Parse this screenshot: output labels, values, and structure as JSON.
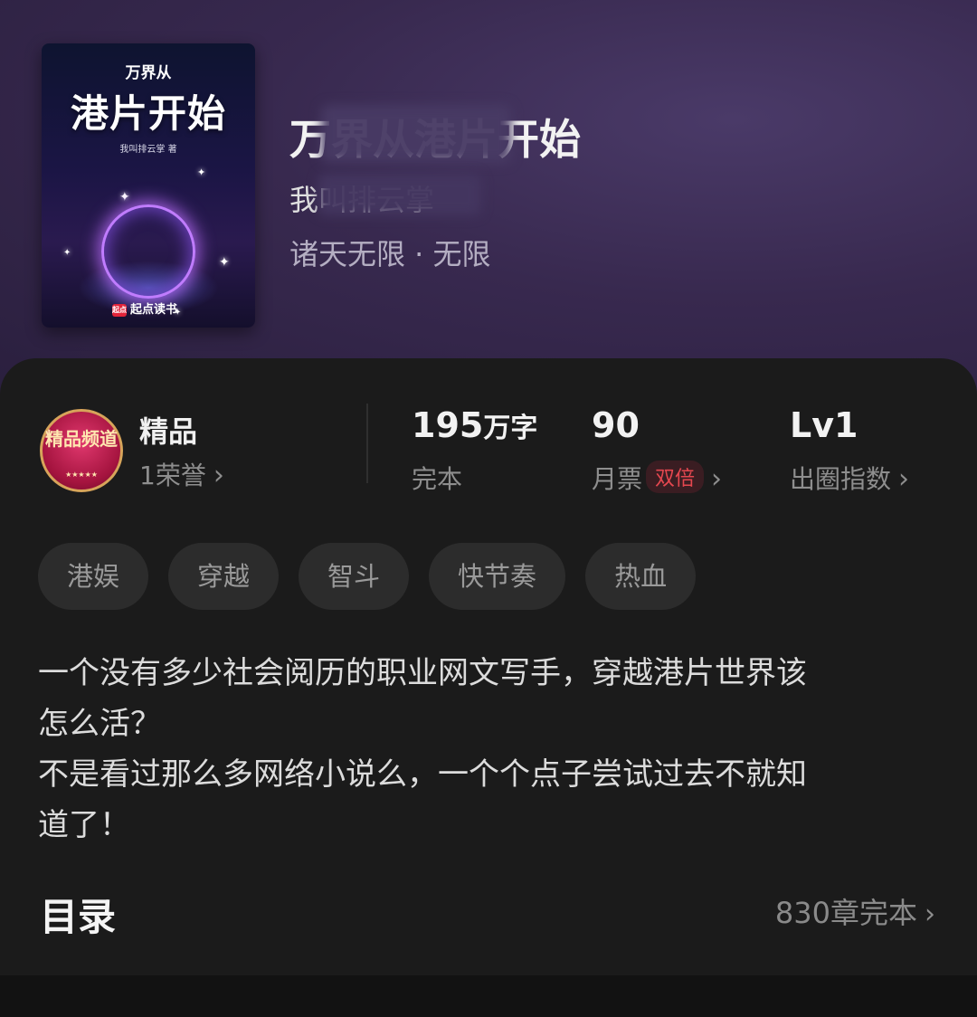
{
  "cover": {
    "top_text": "万界从",
    "main_text": "港片开始",
    "author_text": "我叫排云掌 著",
    "brand": "起点读书",
    "brand_mark": "起点"
  },
  "book": {
    "title": "万界从港片开始",
    "author": "我叫排云掌",
    "genre": "诸天无限 · 无限"
  },
  "honor": {
    "badge_text": "精品频道",
    "badge_stars": "★★★★★",
    "title": "精品",
    "subtitle": "1荣誉"
  },
  "stats": {
    "words": {
      "value": "195",
      "unit": "万字",
      "label": "完本"
    },
    "monthly": {
      "value": "90",
      "label": "月票",
      "badge": "双倍"
    },
    "level": {
      "value": "Lv1",
      "label": "出圈指数"
    }
  },
  "tags": [
    "港娱",
    "穿越",
    "智斗",
    "快节奏",
    "热血"
  ],
  "description": {
    "line1": "一个没有多少社会阅历的职业网文写手，穿越港片世界该",
    "line2": "怎么活？",
    "line3": "不是看过那么多网络小说么，一个个点子尝试过去不就知",
    "line4": "道了！"
  },
  "toc": {
    "title": "目录",
    "count": "830章完本"
  },
  "icons": {
    "chevron": "chevron-right-icon"
  },
  "colors": {
    "hero_bg": "#38294f",
    "card_bg": "#1b1b1b",
    "badge_red": "#e5474f"
  }
}
